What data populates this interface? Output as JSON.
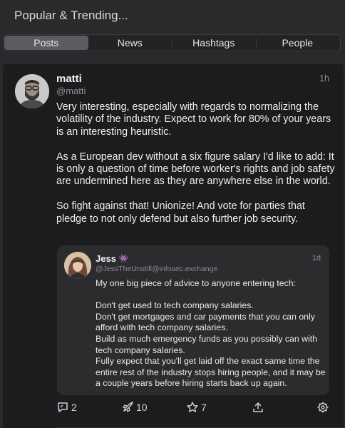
{
  "header": {
    "title": "Popular & Trending..."
  },
  "tabs": [
    {
      "label": "Posts",
      "active": true
    },
    {
      "label": "News",
      "active": false
    },
    {
      "label": "Hashtags",
      "active": false
    },
    {
      "label": "People",
      "active": false
    }
  ],
  "post": {
    "author_name": "matti",
    "author_handle": "@matti",
    "time": "1h",
    "paragraphs": [
      "Very interesting, especially with regards to normalizing the volatility of the industry. Expect to work for 80% of your years is an interesting heuristic.",
      "As a European dev without a six figure salary I'd like to add: It is only a question of time before worker's rights and job safety are undermined here as they are anywhere else in the world.",
      "So fight against that! Unionize! And vote for parties that pledge to not only defend but also further job security."
    ],
    "quote": {
      "author_name": "Jess",
      "author_emoji": "👾",
      "author_handle": "@JessTheUnstill@infosec.exchange",
      "time": "1d",
      "intro": "My one big piece of advice to anyone entering tech:",
      "lines": [
        "Don't get used to tech company salaries.",
        "Don't get mortgages and car payments that you can only afford with tech company salaries.",
        "Build as much emergency funds as you possibly can with tech company salaries.",
        "Fully expect that you'll get laid off the exact same time the entire rest of the industry stops hiring people, and it may be a couple years before hiring starts back up again."
      ]
    },
    "actions": {
      "replies": "2",
      "boosts": "10",
      "favourites": "7"
    }
  },
  "colors": {
    "background": "#2a2a2c",
    "post_background": "#1c1c1e",
    "quote_background": "#2c2c2f",
    "active_tab": "#5c5c60"
  },
  "icons": [
    "reply-icon",
    "boost-icon",
    "star-icon",
    "share-icon",
    "settings-icon"
  ]
}
